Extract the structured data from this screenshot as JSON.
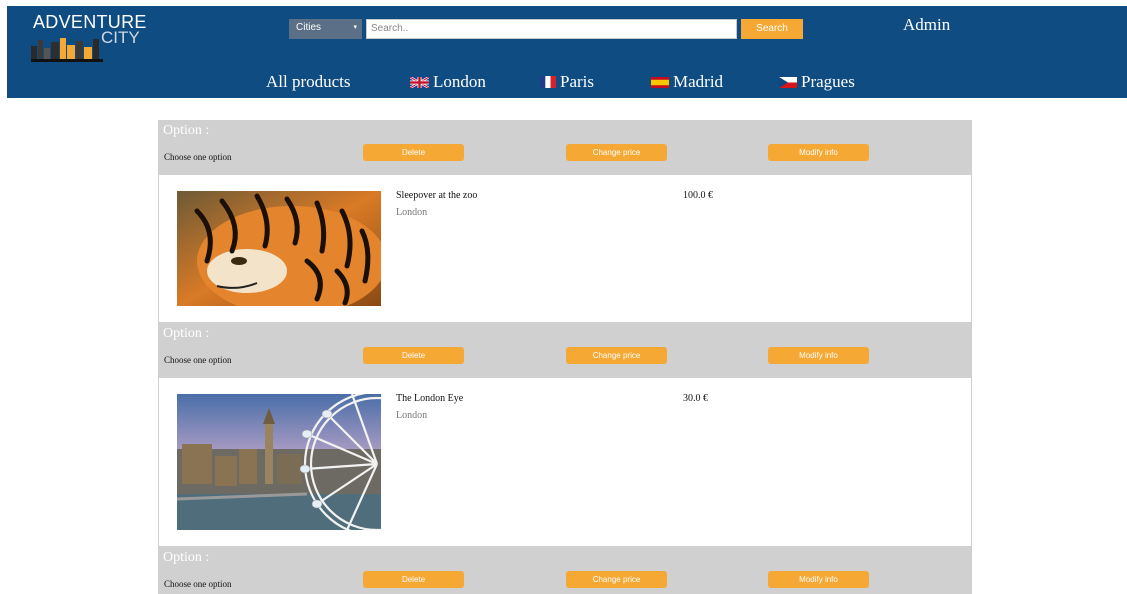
{
  "header": {
    "logo": {
      "line1": "ADVENTURE",
      "line2": "CITY",
      "icon": "city-skyline-logo-icon"
    },
    "city_select": {
      "value": "Cities",
      "caret": "▾"
    },
    "search": {
      "placeholder": "Search..",
      "button": "Search"
    },
    "user": "Admin",
    "nav": [
      {
        "label": "All products"
      },
      {
        "label": "London",
        "flag": "uk-flag-icon"
      },
      {
        "label": "Paris",
        "flag": "france-flag-icon"
      },
      {
        "label": "Madrid",
        "flag": "spain-flag-icon"
      },
      {
        "label": "Pragues",
        "flag": "czech-flag-icon"
      }
    ]
  },
  "option_bar": {
    "title": "Option :",
    "subtitle": "Choose one option",
    "buttons": [
      "Delete",
      "Change price",
      "Modify info"
    ]
  },
  "products": [
    {
      "name": "Sleepover at the zoo",
      "city": "London",
      "price": "100.0 €",
      "image": "tiger-photo"
    },
    {
      "name": "The London Eye",
      "city": "London",
      "price": "30.0 €",
      "image": "london-eye-photo"
    }
  ],
  "colors": {
    "header": "#0f4c81",
    "accent": "#f5a833",
    "panel": "#d0d0d0"
  }
}
